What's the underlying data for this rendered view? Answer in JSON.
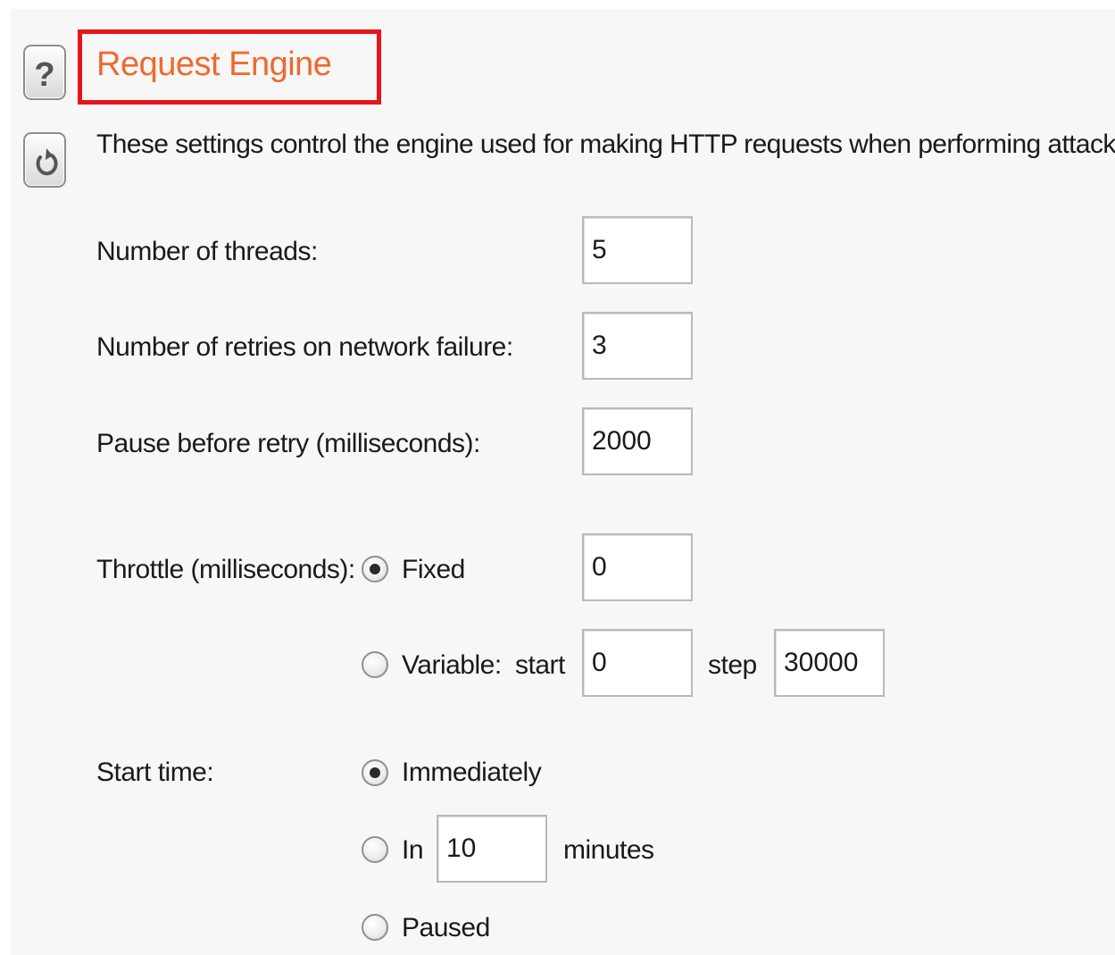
{
  "header": {
    "title": "Request Engine",
    "description": "These settings control the engine used for making HTTP requests when performing attacks.",
    "help_icon": "question-mark-icon",
    "reset_icon": "restore-icon",
    "highlight_color": "#e8141c",
    "title_color": "#ee6a2c"
  },
  "settings": {
    "threads": {
      "label": "Number of threads:",
      "value": "5"
    },
    "retries": {
      "label": "Number of retries on network failure:",
      "value": "3"
    },
    "pause": {
      "label": "Pause before retry (milliseconds):",
      "value": "2000"
    }
  },
  "throttle": {
    "label": "Throttle (milliseconds):",
    "selected": "fixed",
    "fixed": {
      "label": "Fixed",
      "value": "0"
    },
    "variable": {
      "label": "Variable:",
      "start_label": "start",
      "start_value": "0",
      "step_label": "step",
      "step_value": "30000"
    }
  },
  "start_time": {
    "label": "Start time:",
    "selected": "immediately",
    "immediately": {
      "label": "Immediately"
    },
    "in": {
      "label": "In",
      "value": "10",
      "unit": "minutes"
    },
    "paused": {
      "label": "Paused"
    }
  }
}
